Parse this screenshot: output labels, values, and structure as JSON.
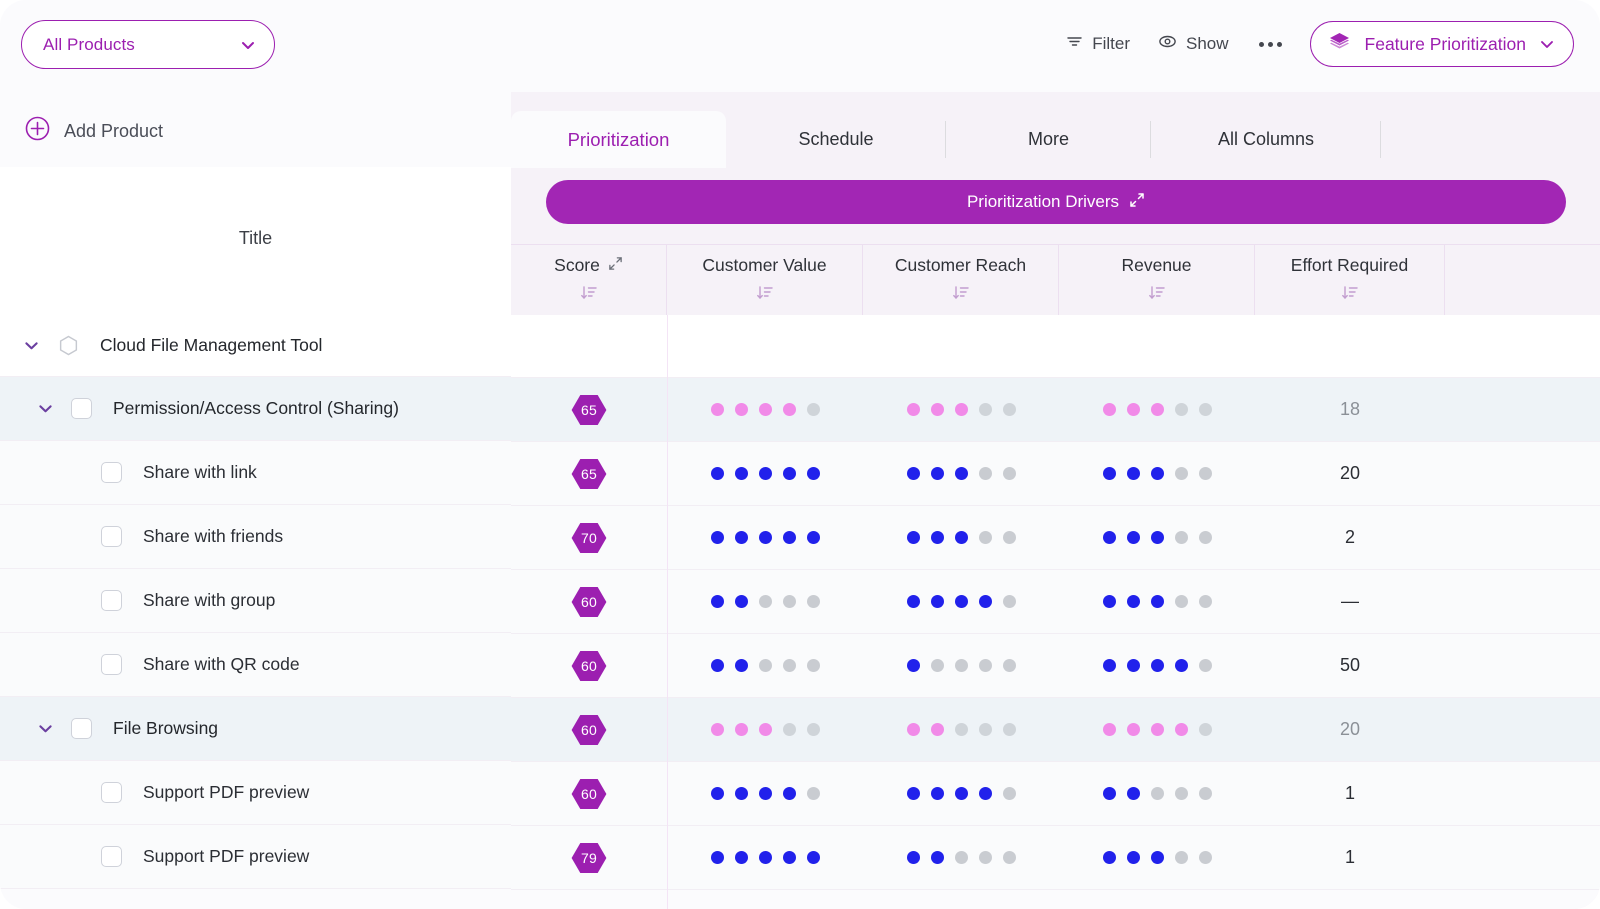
{
  "header": {
    "product_filter": {
      "label": "All Products",
      "icon": "chevron-down-icon"
    },
    "filter_label": "Filter",
    "show_label": "Show",
    "more_label": "•••",
    "view_pill": {
      "label": "Feature Prioritization",
      "icon": "layers-icon"
    }
  },
  "sidebar": {
    "add_product_label": "Add Product",
    "title_header": "Title"
  },
  "tabs": [
    {
      "label": "Prioritization",
      "active": true
    },
    {
      "label": "Schedule",
      "active": false
    },
    {
      "label": "More",
      "active": false
    },
    {
      "label": "All Columns",
      "active": false
    }
  ],
  "banner": {
    "label": "Prioritization Drivers",
    "icon": "expand-arrows-icon"
  },
  "columns": [
    {
      "label": "Score",
      "sort": true,
      "expand": true
    },
    {
      "label": "Customer Value",
      "sort": true,
      "expand": false
    },
    {
      "label": "Customer Reach",
      "sort": true,
      "expand": false
    },
    {
      "label": "Revenue",
      "sort": true,
      "expand": false
    },
    {
      "label": "Effort Required",
      "sort": true,
      "expand": false
    }
  ],
  "rows": [
    {
      "title": "Cloud File Management Tool",
      "level": 0,
      "kind": "product",
      "caret": "expanded",
      "marker": "hexagon-outline-icon",
      "score": null,
      "customer_value": null,
      "customer_reach": null,
      "revenue": null,
      "effort": null,
      "dot_color": null
    },
    {
      "title": "Permission/Access Control (Sharing)",
      "level": 1,
      "kind": "group",
      "caret": "expanded",
      "marker": "checkbox",
      "score": "65",
      "customer_value": 4,
      "customer_reach": 3,
      "revenue": 3,
      "effort": "18",
      "dot_color": "pink"
    },
    {
      "title": "Share with link",
      "level": 2,
      "kind": "leaf",
      "caret": null,
      "marker": "checkbox",
      "score": "65",
      "customer_value": 5,
      "customer_reach": 3,
      "revenue": 3,
      "effort": "20",
      "dot_color": "blue"
    },
    {
      "title": "Share with friends",
      "level": 2,
      "kind": "leaf",
      "caret": null,
      "marker": "checkbox",
      "score": "70",
      "customer_value": 5,
      "customer_reach": 3,
      "revenue": 3,
      "effort": "2",
      "dot_color": "blue"
    },
    {
      "title": "Share with group",
      "level": 2,
      "kind": "leaf",
      "caret": null,
      "marker": "checkbox",
      "score": "60",
      "customer_value": 2,
      "customer_reach": 4,
      "revenue": 3,
      "effort": "—",
      "dot_color": "blue"
    },
    {
      "title": "Share with QR code",
      "level": 2,
      "kind": "leaf",
      "caret": null,
      "marker": "checkbox",
      "score": "60",
      "customer_value": 2,
      "customer_reach": 1,
      "revenue": 4,
      "effort": "50",
      "dot_color": "blue"
    },
    {
      "title": "File Browsing",
      "level": 1,
      "kind": "group",
      "caret": "expanded",
      "marker": "checkbox",
      "score": "60",
      "customer_value": 3,
      "customer_reach": 2,
      "revenue": 4,
      "effort": "20",
      "dot_color": "pink"
    },
    {
      "title": "Support PDF preview",
      "level": 2,
      "kind": "leaf",
      "caret": null,
      "marker": "checkbox",
      "score": "60",
      "customer_value": 4,
      "customer_reach": 4,
      "revenue": 2,
      "effort": "1",
      "dot_color": "blue"
    },
    {
      "title": "Support PDF preview",
      "level": 2,
      "kind": "leaf",
      "caret": null,
      "marker": "checkbox",
      "score": "79",
      "customer_value": 5,
      "customer_reach": 2,
      "revenue": 3,
      "effort": "1",
      "dot_color": "blue"
    }
  ],
  "colors": {
    "accent": "#9c1fb0",
    "banner": "#a226b4",
    "dot_blue": "#2121eb",
    "dot_pink": "#f18ae8",
    "dot_off": "#c9ccd1",
    "row_group_bg": "#eef3f7"
  },
  "dot_scale_max": 5
}
